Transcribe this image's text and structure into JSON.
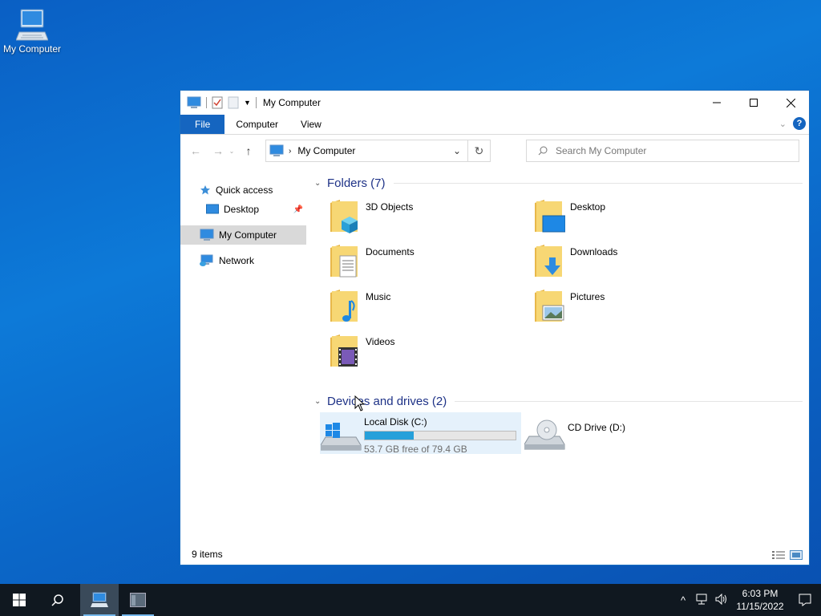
{
  "desktop": {
    "icon_label": "My Computer"
  },
  "window": {
    "title": "My Computer",
    "ribbon": {
      "file": "File",
      "tabs": [
        "Computer",
        "View"
      ],
      "help": "?"
    },
    "address": {
      "crumb": "My Computer"
    },
    "search": {
      "placeholder": "Search My Computer"
    },
    "nav": {
      "quick_access": "Quick access",
      "desktop": "Desktop",
      "my_computer": "My Computer",
      "network": "Network"
    },
    "folders_header": "Folders (7)",
    "folders": [
      {
        "name": "3D Objects"
      },
      {
        "name": "Desktop"
      },
      {
        "name": "Documents"
      },
      {
        "name": "Downloads"
      },
      {
        "name": "Music"
      },
      {
        "name": "Pictures"
      },
      {
        "name": "Videos"
      }
    ],
    "drives_header": "Devices and drives (2)",
    "drives": [
      {
        "name": "Local Disk (C:)",
        "free_text": "53.7 GB free of 79.4 GB",
        "used_fraction": 0.324
      },
      {
        "name": "CD Drive (D:)"
      }
    ],
    "status": "9 items"
  },
  "taskbar": {
    "time": "6:03 PM",
    "date": "11/15/2022"
  },
  "colors": {
    "accent": "#1565c0",
    "drive_bar": "#26a0da",
    "taskbar": "#101820"
  }
}
